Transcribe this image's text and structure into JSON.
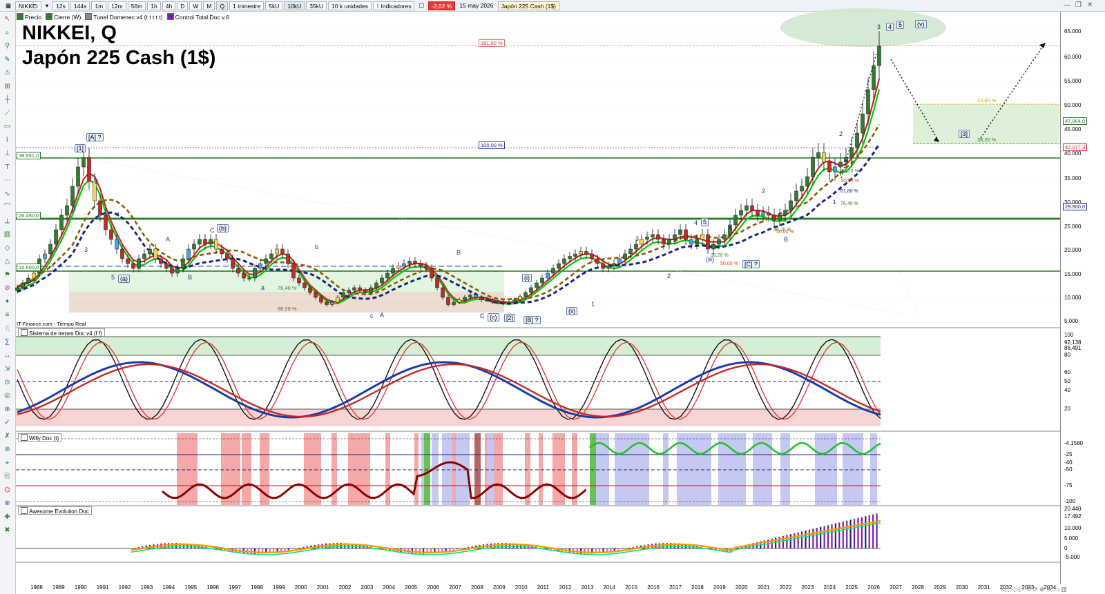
{
  "toolbar": {
    "symbol": "NIKKEI",
    "timeframes": [
      "12s",
      "144s",
      "1m",
      "12m",
      "56m",
      "1h",
      "4h",
      "D",
      "W",
      "M",
      "Q"
    ],
    "active_timeframe": "Q",
    "period": "1 trimestre",
    "units": [
      "5kU",
      "10kU",
      "35kU"
    ],
    "active_unit": "10kU",
    "units_dropdown": "10 k unidades",
    "indicators_label": "Indicadores",
    "change": "-2,02 %",
    "date": "15 may 2026",
    "instrument": "Japón 225 Cash (1$)"
  },
  "legend": {
    "items": [
      "Precio",
      "Cierre (W)",
      "Tunel Domenec v4 (t t t t t)",
      "Control Total Doc v.6"
    ]
  },
  "title": {
    "line1": "NIKKEI, Q",
    "line2": "Japón 225 Cash (1$)"
  },
  "source_label": "IT-Finance.com - Tiempo Real",
  "colors": {
    "up_candle": "#2e7d32",
    "down_candle": "#e53935",
    "tunnel_green": "#00c800",
    "tunnel_red": "#c62828",
    "ma_blue": "#1a237e",
    "ma_brown": "#8b5a00",
    "level_line": "#1b7d1b"
  },
  "price_axis": {
    "labels": [
      "65.000",
      "60.000",
      "55.000",
      "50.000",
      "45.000",
      "40.000",
      "35.000",
      "30.000",
      "25.000",
      "20.000",
      "15.000",
      "10.000",
      "5.000"
    ],
    "tags": [
      {
        "text": "47.864,0",
        "color": "#2e7d32"
      },
      {
        "text": "42.077,3",
        "color": "#c62828"
      },
      {
        "text": "29.900,0",
        "color": "#1a237e"
      }
    ]
  },
  "left_level_tags": [
    "38.951,0",
    "26.450,0",
    "15.600,0"
  ],
  "fib_tags": {
    "top": "161,80 %",
    "mid": "100,00 %",
    "low1": "76,40 %",
    "low2": "88,20 %",
    "target_top": "23,60 %",
    "target_bot": "38,20 %"
  },
  "wave_labels": [
    "[1]",
    "[A] ?",
    "1",
    "2",
    "3",
    "4",
    "5",
    "(a)",
    "A",
    "B",
    "C",
    "(b)",
    "a",
    "b",
    "c",
    "A",
    "B",
    "C",
    "(c)",
    "[2]",
    "[B] ?",
    "(i)",
    "(ii)",
    "1",
    "2",
    "3",
    "4",
    "5",
    "(iii)",
    "A",
    "B",
    "2",
    "1",
    "2",
    "3",
    "4",
    "5",
    "(v)",
    "[3]",
    "[C] ?",
    "[4] ?",
    "(iv)"
  ],
  "wave_ratio_tags": [
    "38,20 %",
    "50,00 %",
    "61,80 %",
    "76,40 %",
    "38,20 %",
    "50,00 %",
    "38,20 %",
    "50,00 %"
  ],
  "pane2": {
    "label": "Sistema de trenes Doc v4 (f f)",
    "axis": [
      "100",
      "92,138",
      "86,491",
      "80",
      "60",
      "50",
      "40",
      "20"
    ]
  },
  "pane3": {
    "label": "Willy Doc (t)",
    "axis": [
      "-4,1580",
      "-25",
      "-40",
      "-50",
      "-75",
      "-100"
    ]
  },
  "pane4": {
    "label": "Awesome Evolution Doc",
    "axis": [
      "20.440",
      "17.492",
      "10.000",
      "5.000",
      "0",
      "-5.000"
    ]
  },
  "x_axis": {
    "years": [
      "1988",
      "1989",
      "1990",
      "1991",
      "1992",
      "1993",
      "1994",
      "1995",
      "1996",
      "1997",
      "1998",
      "1999",
      "2000",
      "2001",
      "2002",
      "2003",
      "2004",
      "2005",
      "2006",
      "2007",
      "2008",
      "2009",
      "2010",
      "2011",
      "2012",
      "2013",
      "2014",
      "2015",
      "2016",
      "2017",
      "2018",
      "2019",
      "2020",
      "2021",
      "2022",
      "2023",
      "2024",
      "2025",
      "2026",
      "2027",
      "2028",
      "2029",
      "2030",
      "2031",
      "2032",
      "2033",
      "2034"
    ]
  }
}
